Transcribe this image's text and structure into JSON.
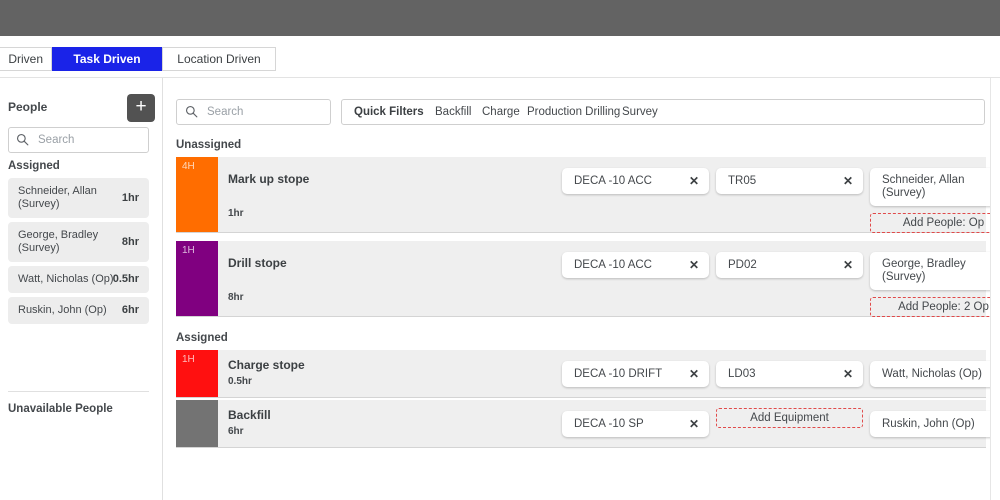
{
  "top_bar": {
    "color": "#636363"
  },
  "tabs": [
    {
      "label": "Driven",
      "active": false
    },
    {
      "label": "Task Driven",
      "active": true
    },
    {
      "label": "Location Driven",
      "active": false
    }
  ],
  "tab_active_color": "#1a23e8",
  "sidebar": {
    "title": "People",
    "add_button_label": "+",
    "search": {
      "value": "",
      "placeholder": "Search",
      "icon": "search-icon"
    },
    "assigned_label": "Assigned",
    "unavailable_label": "Unavailable People",
    "people": [
      {
        "name": "Schneider, Allan (Survey)",
        "hours": "1hr"
      },
      {
        "name": "George, Bradley (Survey)",
        "hours": "8hr"
      },
      {
        "name": "Watt, Nicholas (Op)",
        "hours": "0.5hr"
      },
      {
        "name": "Ruskin, John (Op)",
        "hours": "6hr"
      }
    ]
  },
  "main": {
    "search": {
      "value": "",
      "placeholder": "Search",
      "icon": "search-icon"
    },
    "quick_filters_label": "Quick Filters",
    "quick_filters": [
      "Backfill",
      "Charge",
      "Production Drilling",
      "Survey"
    ],
    "groups": [
      {
        "label": "Unassigned"
      },
      {
        "label": "Assigned"
      }
    ],
    "tasks": [
      {
        "title": "Mark up stope",
        "duration": "1hr",
        "color": "#FF6D00",
        "badge": "4H",
        "location": "DECA -10 ACC",
        "equipment": "TR05",
        "person": "Schneider, Allan (Survey)",
        "add_people": "Add People: Op",
        "remove_icon": "close-icon"
      },
      {
        "title": "Drill stope",
        "duration": "8hr",
        "color": "#800080",
        "badge": "1H",
        "location": "DECA -10 ACC",
        "equipment": "PD02",
        "person": "George, Bradley (Survey)",
        "add_people": "Add People: 2 Op",
        "remove_icon": "close-icon"
      },
      {
        "title": "Charge stope",
        "duration": "0.5hr",
        "color": "#FF1010",
        "badge": "1H",
        "location": "DECA -10 DRIFT",
        "equipment": "LD03",
        "person": "Watt, Nicholas (Op)",
        "add_people": "",
        "remove_icon": "close-icon"
      },
      {
        "title": "Backfill",
        "duration": "6hr",
        "color": "#737373",
        "badge": "",
        "location": "DECA -10 SP",
        "equipment": "",
        "add_equipment": "Add Equipment",
        "person": "Ruskin, John (Op)",
        "add_people": "",
        "remove_icon": "close-icon"
      }
    ],
    "chip_remove_label": "✕",
    "dashed_border_color": "#e04a4a"
  }
}
